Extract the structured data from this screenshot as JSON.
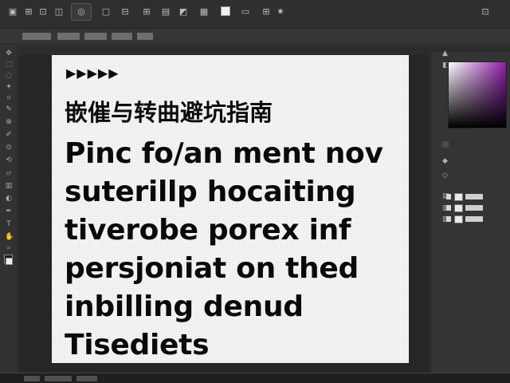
{
  "toolbar": {
    "icons": [
      "file-icon",
      "undo-icon",
      "redo-icon",
      "layers-icon",
      "camera-icon",
      "frame-icon",
      "crop-icon",
      "grid-icon",
      "align-icon",
      "brush-icon",
      "text-icon",
      "color-swatch",
      "measure-icon",
      "settings-icon",
      "window-icon"
    ]
  },
  "canvas": {
    "arrows": "▶▶▶▶▶",
    "heading": "嵌催与转曲避坑指南",
    "lines": [
      "Pinc fo/an  ment nov",
      "suterillp hocaiting",
      "tiverobe porex inf",
      "persjoniat on thed",
      "inbilling denud",
      "Tisediets"
    ]
  },
  "colors": {
    "canvas_bg": "#f3f3f3",
    "workspace_bg": "#262626",
    "picker_hue": "#8e1ea8"
  }
}
